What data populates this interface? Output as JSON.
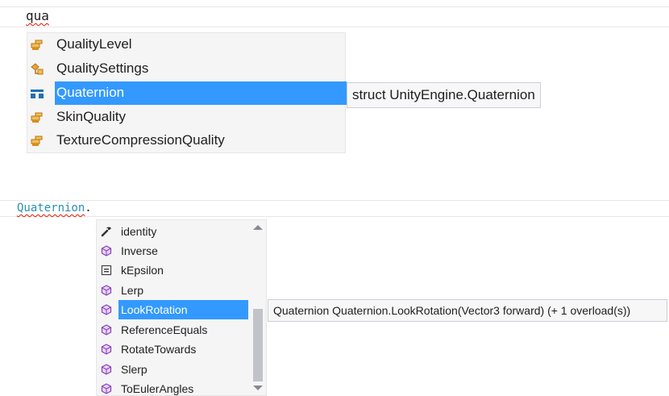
{
  "editor_top": {
    "typed_text": "qua"
  },
  "completion_top": {
    "items": [
      {
        "label": "QualityLevel",
        "icon": "enum-icon"
      },
      {
        "label": "QualitySettings",
        "icon": "class-icon"
      },
      {
        "label": "Quaternion",
        "icon": "struct-icon",
        "selected": true
      },
      {
        "label": "SkinQuality",
        "icon": "enum-icon"
      },
      {
        "label": "TextureCompressionQuality",
        "icon": "enum-icon"
      }
    ],
    "tooltip": "struct UnityEngine.Quaternion"
  },
  "editor_bottom": {
    "type_text": "Quaternion",
    "dot_text": "."
  },
  "completion_bottom": {
    "items": [
      {
        "label": "identity",
        "icon": "property-icon"
      },
      {
        "label": "Inverse",
        "icon": "method-icon"
      },
      {
        "label": "kEpsilon",
        "icon": "field-icon"
      },
      {
        "label": "Lerp",
        "icon": "method-icon"
      },
      {
        "label": "LookRotation",
        "icon": "method-icon",
        "selected": true
      },
      {
        "label": "ReferenceEquals",
        "icon": "method-icon"
      },
      {
        "label": "RotateTowards",
        "icon": "method-icon"
      },
      {
        "label": "Slerp",
        "icon": "method-icon"
      },
      {
        "label": "ToEulerAngles",
        "icon": "method-icon"
      }
    ],
    "tooltip": "Quaternion Quaternion.LookRotation(Vector3 forward)  (+ 1 overload(s))"
  },
  "colors": {
    "selection": "#3399ff",
    "enum_icon": "#d98c1c",
    "struct_icon": "#1e6fb8",
    "method_icon": "#8a3ec1",
    "type_name": "#2b91af",
    "error_squiggle": "#e51400"
  }
}
